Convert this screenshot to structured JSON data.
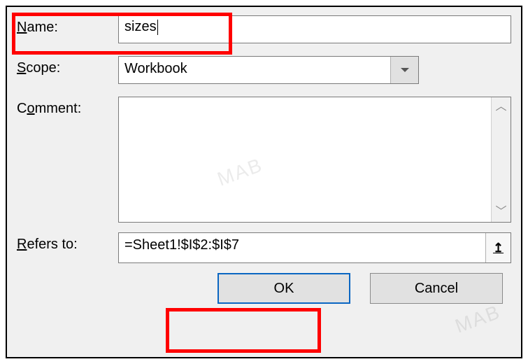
{
  "labels": {
    "name": "ame:",
    "name_access": "N",
    "scope": "cope:",
    "scope_access": "S",
    "comment": "omment:",
    "comment_access": "C",
    "refers": "efers to:",
    "refers_access": "R"
  },
  "fields": {
    "name_value": "sizes",
    "scope_value": "Workbook",
    "comment_value": "",
    "refers_value": "=Sheet1!$I$2:$I$7"
  },
  "buttons": {
    "ok": "OK",
    "cancel": "Cancel"
  },
  "watermark": "MAB"
}
